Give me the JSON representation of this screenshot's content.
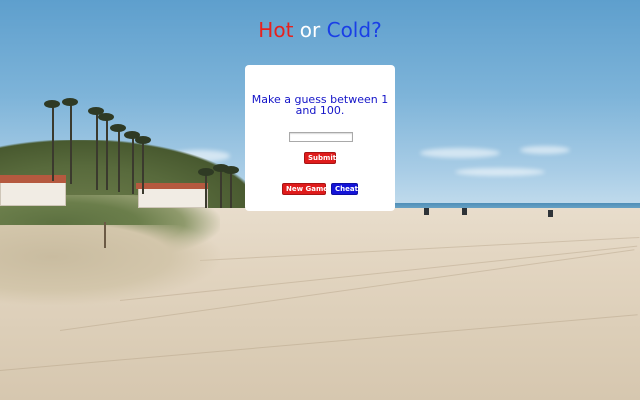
{
  "title": {
    "hot": "Hot",
    "or": "or",
    "cold": "Cold?"
  },
  "game": {
    "prompt": "Make a guess between 1 and 100.",
    "guess_value": "",
    "submit_label": "Submit",
    "new_game_label": "New Game",
    "cheat_label": "Cheat"
  },
  "colors": {
    "hot": "#e8211d",
    "cold": "#1a3fe6",
    "prompt_text": "#1414c8",
    "submit_bg": "#df1b1b",
    "new_game_bg": "#df1b1b",
    "cheat_bg": "#1414d8",
    "panel_bg": "#ffffff"
  },
  "background": {
    "scene": "beach"
  }
}
